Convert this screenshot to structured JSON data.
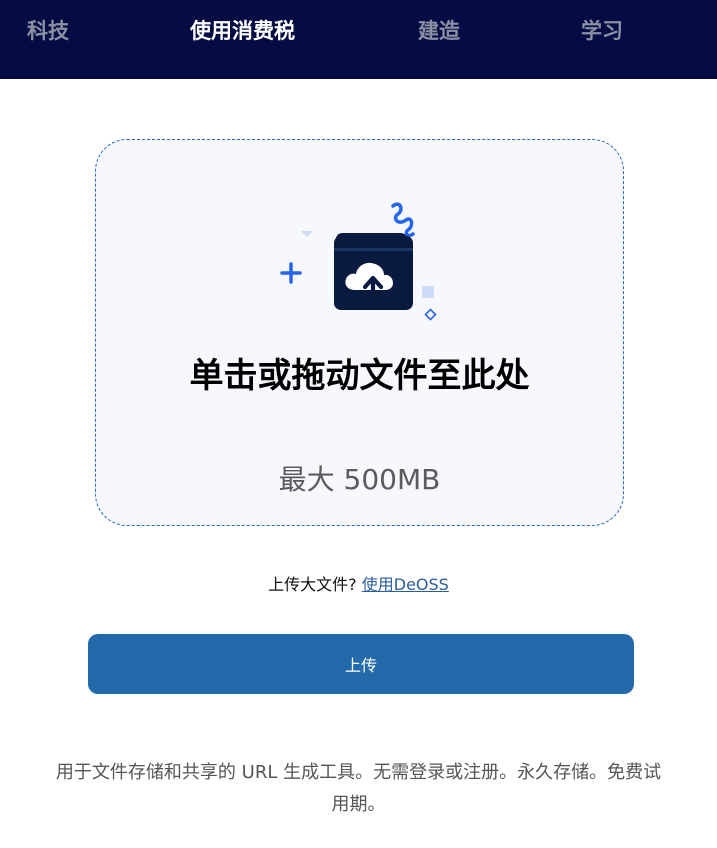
{
  "nav": {
    "items": [
      {
        "label": "科技",
        "active": false
      },
      {
        "label": "使用消费税",
        "active": true
      },
      {
        "label": "建造",
        "active": false
      },
      {
        "label": "学习",
        "active": false
      }
    ]
  },
  "dropzone": {
    "title": "单击或拖动文件至此处",
    "subtitle": "最大 500MB",
    "icon": "cloud-upload-icon"
  },
  "large_file": {
    "prompt": "上传大文件?",
    "link_label": "使用DeOSS"
  },
  "upload_button": {
    "label": "上传"
  },
  "description": "用于文件存储和共享的 URL 生成工具。无需登录或注册。永久存储。免费试用期。",
  "colors": {
    "nav_background": "#050c44",
    "accent": "#236aab",
    "dropzone_border": "#2a66c8",
    "dropzone_background": "#f6f8fd",
    "icon_dark": "#081a3f",
    "icon_blue": "#2864e8"
  }
}
